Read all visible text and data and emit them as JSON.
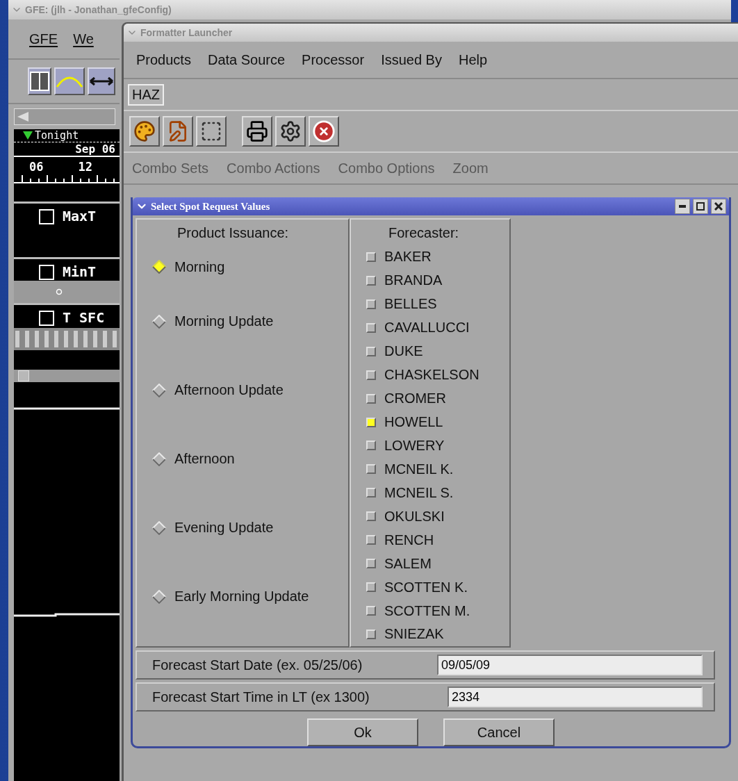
{
  "gfe_window": {
    "title": "GFE: (jlh - Jonathan_gfeConfig)",
    "menu": [
      "GFE",
      "We"
    ],
    "timeline": {
      "period": "Tonight",
      "date": "Sep 06",
      "hours": [
        "06",
        "12"
      ]
    },
    "grids": [
      {
        "name": "MaxT",
        "checked": false
      },
      {
        "name": "MinT",
        "checked": false
      },
      {
        "name": "T SFC",
        "checked": false
      }
    ],
    "time_slider": {
      "level": 0.04
    }
  },
  "launcher": {
    "title": "Formatter Launcher",
    "menu": [
      "Products",
      "Data Source",
      "Processor",
      "Issued By",
      "Help"
    ],
    "tabs": [
      {
        "label": "HAZ",
        "selected": true
      }
    ],
    "combo_menu": [
      {
        "label": "Combo Sets",
        "disabled": true
      },
      {
        "label": "Combo Actions",
        "disabled": true
      },
      {
        "label": "Combo Options",
        "disabled": true
      },
      {
        "label": "Zoom",
        "disabled": true
      }
    ]
  },
  "dialog": {
    "title": "Select Spot Request Values",
    "issuance_heading": "Product Issuance:",
    "issuance": [
      {
        "label": "Morning",
        "selected": true
      },
      {
        "label": "Morning Update",
        "selected": false
      },
      {
        "label": "Afternoon Update",
        "selected": false
      },
      {
        "label": "Afternoon",
        "selected": false
      },
      {
        "label": "Evening Update",
        "selected": false
      },
      {
        "label": "Early Morning Update",
        "selected": false
      }
    ],
    "forecaster_heading": "Forecaster:",
    "forecasters": [
      {
        "name": "BAKER",
        "checked": false
      },
      {
        "name": "BRANDA",
        "checked": false
      },
      {
        "name": "BELLES",
        "checked": false
      },
      {
        "name": "CAVALLUCCI",
        "checked": false
      },
      {
        "name": "DUKE",
        "checked": false
      },
      {
        "name": "CHASKELSON",
        "checked": false
      },
      {
        "name": "CROMER",
        "checked": false
      },
      {
        "name": "HOWELL",
        "checked": true
      },
      {
        "name": "LOWERY",
        "checked": false
      },
      {
        "name": "MCNEIL K.",
        "checked": false
      },
      {
        "name": "MCNEIL S.",
        "checked": false
      },
      {
        "name": "OKULSKI",
        "checked": false
      },
      {
        "name": "RENCH",
        "checked": false
      },
      {
        "name": "SALEM",
        "checked": false
      },
      {
        "name": "SCOTTEN K.",
        "checked": false
      },
      {
        "name": "SCOTTEN M.",
        "checked": false
      },
      {
        "name": "SNIEZAK",
        "checked": false
      }
    ],
    "fields": [
      {
        "label": "Forecast Start Date (ex. 05/25/06)",
        "value": "09/05/09"
      },
      {
        "label": "Forecast Start Time in LT (ex 1300)",
        "value": "2334"
      }
    ],
    "buttons": [
      "Ok",
      "Cancel"
    ]
  }
}
